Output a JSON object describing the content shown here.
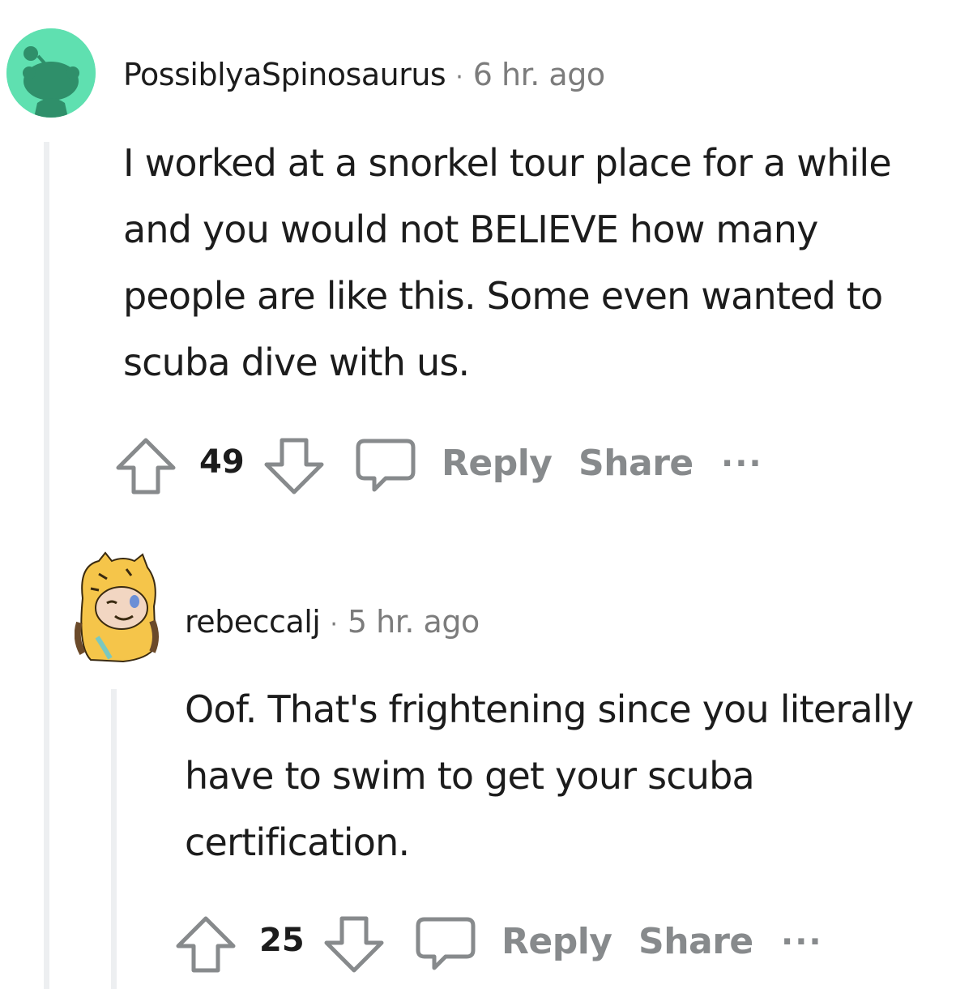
{
  "comments": [
    {
      "username": "PossiblyaSpinosaurus",
      "separator": "·",
      "time": "6 hr. ago",
      "body": "I worked at a snorkel tour place for a while and you would not BELIEVE how many people are like this. Some even wanted to scuba dive with us.",
      "votes": "49",
      "reply_label": "Reply",
      "share_label": "Share",
      "more_label": "···",
      "avatar_color": "#5fe0b0"
    },
    {
      "username": "rebeccalj",
      "separator": "·",
      "time": "5 hr. ago",
      "body": "Oof. That's frightening since you literally have to swim to get your scuba certification.",
      "votes": "25",
      "reply_label": "Reply",
      "share_label": "Share",
      "more_label": "···",
      "avatar_color": "#f5c54a"
    }
  ],
  "colors": {
    "text": "#1c1c1c",
    "meta": "#7c7c7c",
    "action": "#878a8c",
    "thread_line": "#edeff1"
  }
}
